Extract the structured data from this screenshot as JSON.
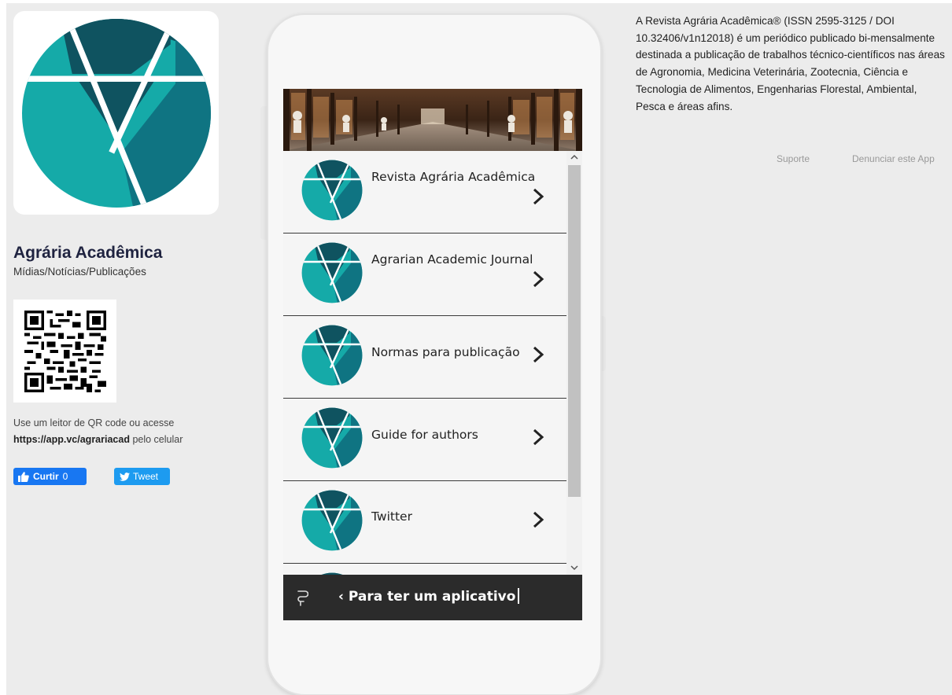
{
  "app": {
    "name": "Agrária Acadêmica",
    "category": "Mídias/Notícias/Publicações"
  },
  "qr": {
    "hint_prefix": "Use um leitor de QR code ou acesse",
    "url": "https://app.vc/agrariacad",
    "hint_suffix": " pelo celular"
  },
  "social": {
    "facebook_label": "Curtir",
    "facebook_count": "0",
    "twitter_label": "Tweet"
  },
  "menu": {
    "items": [
      {
        "label": "Revista Agrária Acadêmica"
      },
      {
        "label": "Agrarian Academic Journal"
      },
      {
        "label": "Normas para publicação"
      },
      {
        "label": "Guide for authors"
      },
      {
        "label": "Twitter"
      }
    ]
  },
  "bottom_bar": {
    "text": "‹ Para ter um aplicativo"
  },
  "description": "A Revista Agrária Acadêmica® (ISSN 2595-3125 / DOI 10.32406/v1n12018) é um periódico publicado bi-mensalmente destinada a publicação de trabalhos técnico-científicos nas áreas de Agronomia, Medicina Veterinária, Zootecnia, Ciência e Tecnologia de Alimentos, Engenharias Florestal, Ambiental, Pesca e áreas afins.",
  "links": {
    "support": "Suporte",
    "report": "Denunciar este App"
  },
  "colors": {
    "logo_dark": "#0f5360",
    "logo_mid": "#0f7482",
    "logo_light": "#15aaa8",
    "facebook": "#1877f2",
    "twitter": "#1d9bf0",
    "bottom_bar": "#2b2b2b"
  }
}
